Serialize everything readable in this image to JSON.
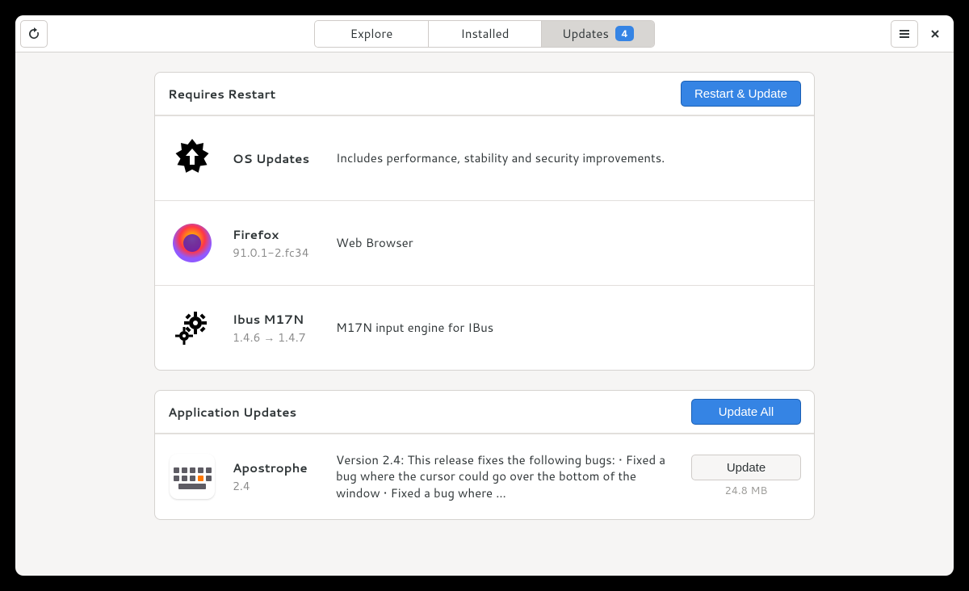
{
  "tabs": {
    "explore": "Explore",
    "installed": "Installed",
    "updates": "Updates",
    "badge": "4"
  },
  "sections": {
    "restart": {
      "title": "Requires Restart",
      "button": "Restart & Update",
      "items": [
        {
          "title": "OS Updates",
          "version": "",
          "desc": "Includes performance, stability and security improvements."
        },
        {
          "title": "Firefox",
          "version": "91.0.1-2.fc34",
          "desc": "Web Browser"
        },
        {
          "title": "Ibus M17N",
          "version": "1.4.6 → 1.4.7",
          "desc": "M17N input engine for IBus"
        }
      ]
    },
    "apps": {
      "title": "Application Updates",
      "button": "Update All",
      "items": [
        {
          "title": "Apostrophe",
          "version": "2.4",
          "desc": "Version 2.4: This release fixes the following bugs:   • Fixed a bug where the cursor could go over the bottom of the window  • Fixed a bug where …",
          "action": "Update",
          "size": "24.8 MB"
        }
      ]
    }
  }
}
